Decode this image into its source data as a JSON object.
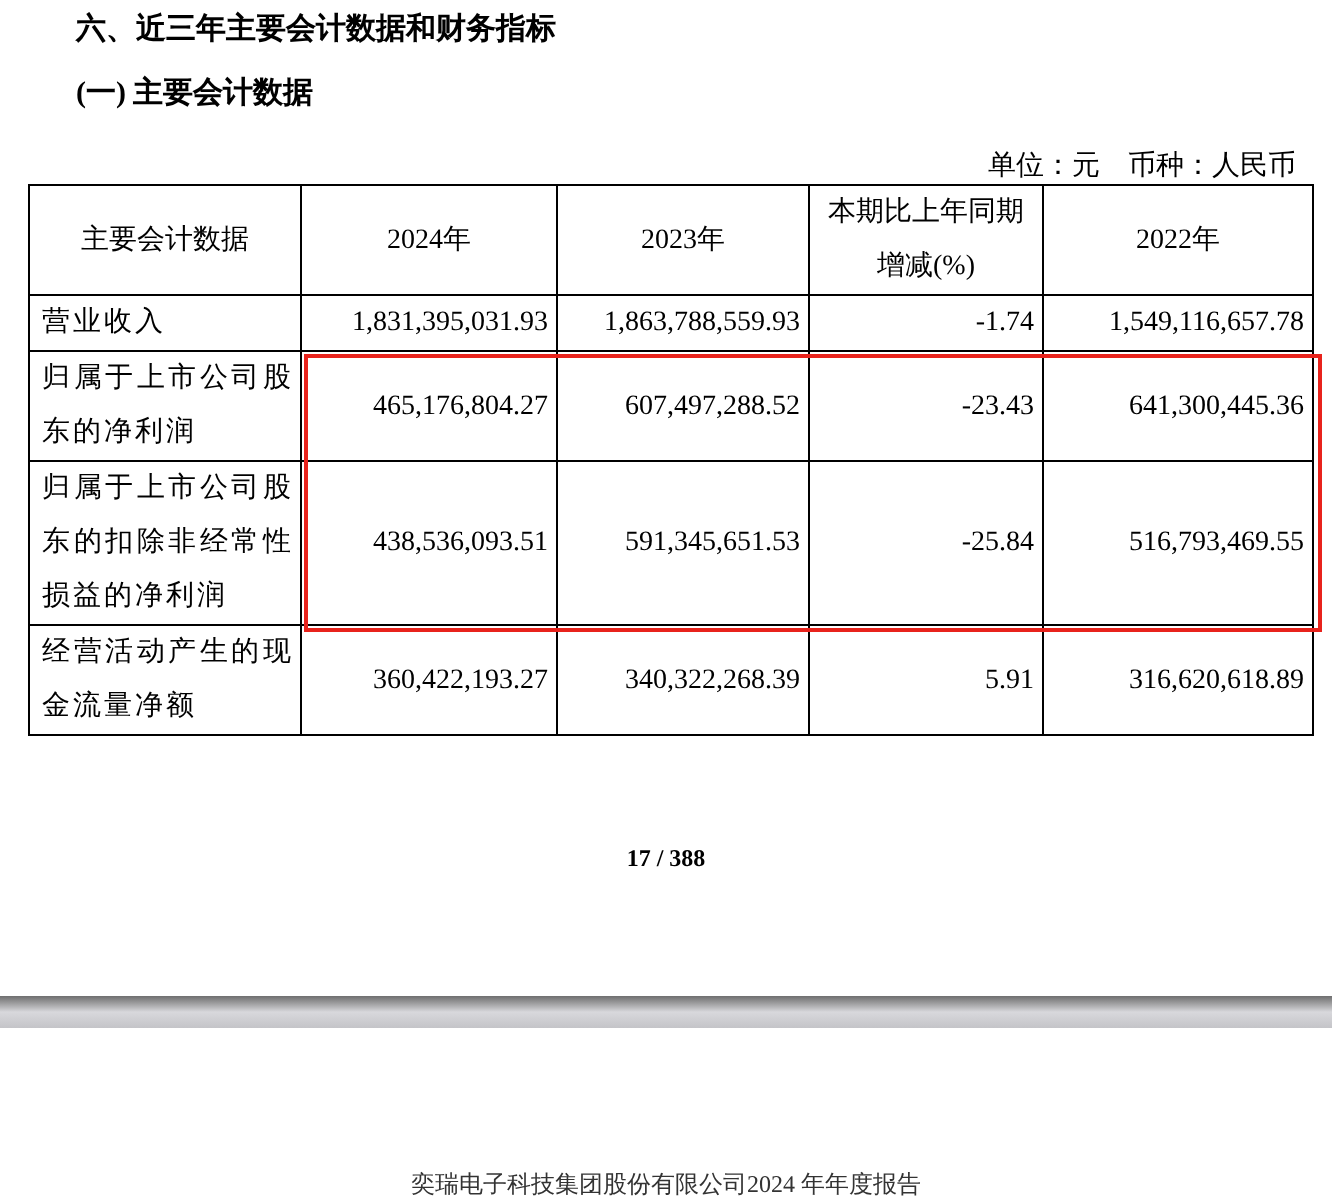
{
  "heading": "六、近三年主要会计数据和财务指标",
  "subheading": "(一) 主要会计数据",
  "unit_note": [
    "单位：元",
    "币种：人民币"
  ],
  "table": {
    "columns": [
      "主要会计数据",
      "2024年",
      "2023年",
      "本期比上年同期增减(%)",
      "2022年"
    ],
    "rows": [
      {
        "cells": [
          "营业收入",
          "1,831,395,031.93",
          "1,863,788,559.93",
          "-1.74",
          "1,549,116,657.78"
        ],
        "highlighted": false
      },
      {
        "cells": [
          "归属于上市公司股东的净利润",
          "465,176,804.27",
          "607,497,288.52",
          "-23.43",
          "641,300,445.36"
        ],
        "highlighted": true
      },
      {
        "cells": [
          "归属于上市公司股东的扣除非经常性损益的净利润",
          "438,536,093.51",
          "591,345,651.53",
          "-25.84",
          "516,793,469.55"
        ],
        "highlighted": true
      },
      {
        "cells": [
          "经营活动产生的现金流量净额",
          "360,422,193.27",
          "340,322,268.39",
          "5.91",
          "316,620,618.89"
        ],
        "highlighted": false
      }
    ]
  },
  "page_number": "17 / 388",
  "next_page_header": "奕瑞电子科技集团股份有限公司2024 年年度报告"
}
